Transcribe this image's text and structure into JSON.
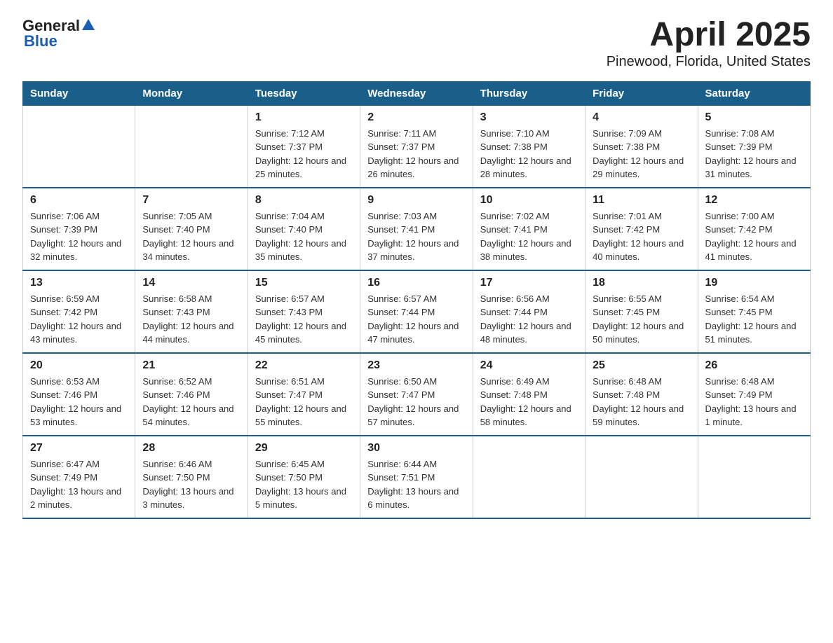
{
  "header": {
    "logo": {
      "general_text": "General",
      "blue_text": "Blue"
    },
    "title": "April 2025",
    "subtitle": "Pinewood, Florida, United States"
  },
  "calendar": {
    "days_of_week": [
      "Sunday",
      "Monday",
      "Tuesday",
      "Wednesday",
      "Thursday",
      "Friday",
      "Saturday"
    ],
    "weeks": [
      [
        {
          "day": "",
          "info": ""
        },
        {
          "day": "",
          "info": ""
        },
        {
          "day": "1",
          "info": "Sunrise: 7:12 AM\nSunset: 7:37 PM\nDaylight: 12 hours and 25 minutes."
        },
        {
          "day": "2",
          "info": "Sunrise: 7:11 AM\nSunset: 7:37 PM\nDaylight: 12 hours and 26 minutes."
        },
        {
          "day": "3",
          "info": "Sunrise: 7:10 AM\nSunset: 7:38 PM\nDaylight: 12 hours and 28 minutes."
        },
        {
          "day": "4",
          "info": "Sunrise: 7:09 AM\nSunset: 7:38 PM\nDaylight: 12 hours and 29 minutes."
        },
        {
          "day": "5",
          "info": "Sunrise: 7:08 AM\nSunset: 7:39 PM\nDaylight: 12 hours and 31 minutes."
        }
      ],
      [
        {
          "day": "6",
          "info": "Sunrise: 7:06 AM\nSunset: 7:39 PM\nDaylight: 12 hours and 32 minutes."
        },
        {
          "day": "7",
          "info": "Sunrise: 7:05 AM\nSunset: 7:40 PM\nDaylight: 12 hours and 34 minutes."
        },
        {
          "day": "8",
          "info": "Sunrise: 7:04 AM\nSunset: 7:40 PM\nDaylight: 12 hours and 35 minutes."
        },
        {
          "day": "9",
          "info": "Sunrise: 7:03 AM\nSunset: 7:41 PM\nDaylight: 12 hours and 37 minutes."
        },
        {
          "day": "10",
          "info": "Sunrise: 7:02 AM\nSunset: 7:41 PM\nDaylight: 12 hours and 38 minutes."
        },
        {
          "day": "11",
          "info": "Sunrise: 7:01 AM\nSunset: 7:42 PM\nDaylight: 12 hours and 40 minutes."
        },
        {
          "day": "12",
          "info": "Sunrise: 7:00 AM\nSunset: 7:42 PM\nDaylight: 12 hours and 41 minutes."
        }
      ],
      [
        {
          "day": "13",
          "info": "Sunrise: 6:59 AM\nSunset: 7:42 PM\nDaylight: 12 hours and 43 minutes."
        },
        {
          "day": "14",
          "info": "Sunrise: 6:58 AM\nSunset: 7:43 PM\nDaylight: 12 hours and 44 minutes."
        },
        {
          "day": "15",
          "info": "Sunrise: 6:57 AM\nSunset: 7:43 PM\nDaylight: 12 hours and 45 minutes."
        },
        {
          "day": "16",
          "info": "Sunrise: 6:57 AM\nSunset: 7:44 PM\nDaylight: 12 hours and 47 minutes."
        },
        {
          "day": "17",
          "info": "Sunrise: 6:56 AM\nSunset: 7:44 PM\nDaylight: 12 hours and 48 minutes."
        },
        {
          "day": "18",
          "info": "Sunrise: 6:55 AM\nSunset: 7:45 PM\nDaylight: 12 hours and 50 minutes."
        },
        {
          "day": "19",
          "info": "Sunrise: 6:54 AM\nSunset: 7:45 PM\nDaylight: 12 hours and 51 minutes."
        }
      ],
      [
        {
          "day": "20",
          "info": "Sunrise: 6:53 AM\nSunset: 7:46 PM\nDaylight: 12 hours and 53 minutes."
        },
        {
          "day": "21",
          "info": "Sunrise: 6:52 AM\nSunset: 7:46 PM\nDaylight: 12 hours and 54 minutes."
        },
        {
          "day": "22",
          "info": "Sunrise: 6:51 AM\nSunset: 7:47 PM\nDaylight: 12 hours and 55 minutes."
        },
        {
          "day": "23",
          "info": "Sunrise: 6:50 AM\nSunset: 7:47 PM\nDaylight: 12 hours and 57 minutes."
        },
        {
          "day": "24",
          "info": "Sunrise: 6:49 AM\nSunset: 7:48 PM\nDaylight: 12 hours and 58 minutes."
        },
        {
          "day": "25",
          "info": "Sunrise: 6:48 AM\nSunset: 7:48 PM\nDaylight: 12 hours and 59 minutes."
        },
        {
          "day": "26",
          "info": "Sunrise: 6:48 AM\nSunset: 7:49 PM\nDaylight: 13 hours and 1 minute."
        }
      ],
      [
        {
          "day": "27",
          "info": "Sunrise: 6:47 AM\nSunset: 7:49 PM\nDaylight: 13 hours and 2 minutes."
        },
        {
          "day": "28",
          "info": "Sunrise: 6:46 AM\nSunset: 7:50 PM\nDaylight: 13 hours and 3 minutes."
        },
        {
          "day": "29",
          "info": "Sunrise: 6:45 AM\nSunset: 7:50 PM\nDaylight: 13 hours and 5 minutes."
        },
        {
          "day": "30",
          "info": "Sunrise: 6:44 AM\nSunset: 7:51 PM\nDaylight: 13 hours and 6 minutes."
        },
        {
          "day": "",
          "info": ""
        },
        {
          "day": "",
          "info": ""
        },
        {
          "day": "",
          "info": ""
        }
      ]
    ]
  }
}
